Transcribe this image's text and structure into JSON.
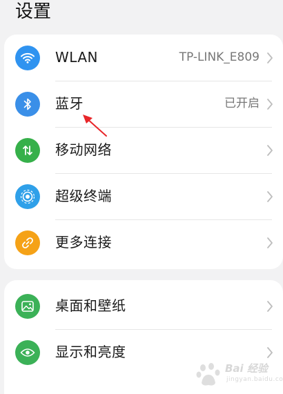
{
  "header": {
    "title": "设置"
  },
  "groups": [
    {
      "items": [
        {
          "label": "WLAN",
          "value": "TP-LINK_E809",
          "icon": "wifi-icon",
          "icon_color": "#2f93f0"
        },
        {
          "label": "蓝牙",
          "value": "已开启",
          "icon": "bluetooth-icon",
          "icon_color": "#3a8fe8"
        },
        {
          "label": "移动网络",
          "value": "",
          "icon": "mobile-data-icon",
          "icon_color": "#36b04a"
        },
        {
          "label": "超级终端",
          "value": "",
          "icon": "super-device-icon",
          "icon_color": "#2fa0e9"
        },
        {
          "label": "更多连接",
          "value": "",
          "icon": "link-icon",
          "icon_color": "#f5a217"
        }
      ]
    },
    {
      "items": [
        {
          "label": "桌面和壁纸",
          "value": "",
          "icon": "wallpaper-icon",
          "icon_color": "#3bb157"
        },
        {
          "label": "显示和亮度",
          "value": "",
          "icon": "eye-icon",
          "icon_color": "#3bb157"
        }
      ]
    }
  ],
  "annotation": {
    "target": "蓝牙",
    "color": "#e8262a"
  },
  "watermark": {
    "text": "Bai 经验",
    "sub": "jingyan.baidu.com"
  }
}
